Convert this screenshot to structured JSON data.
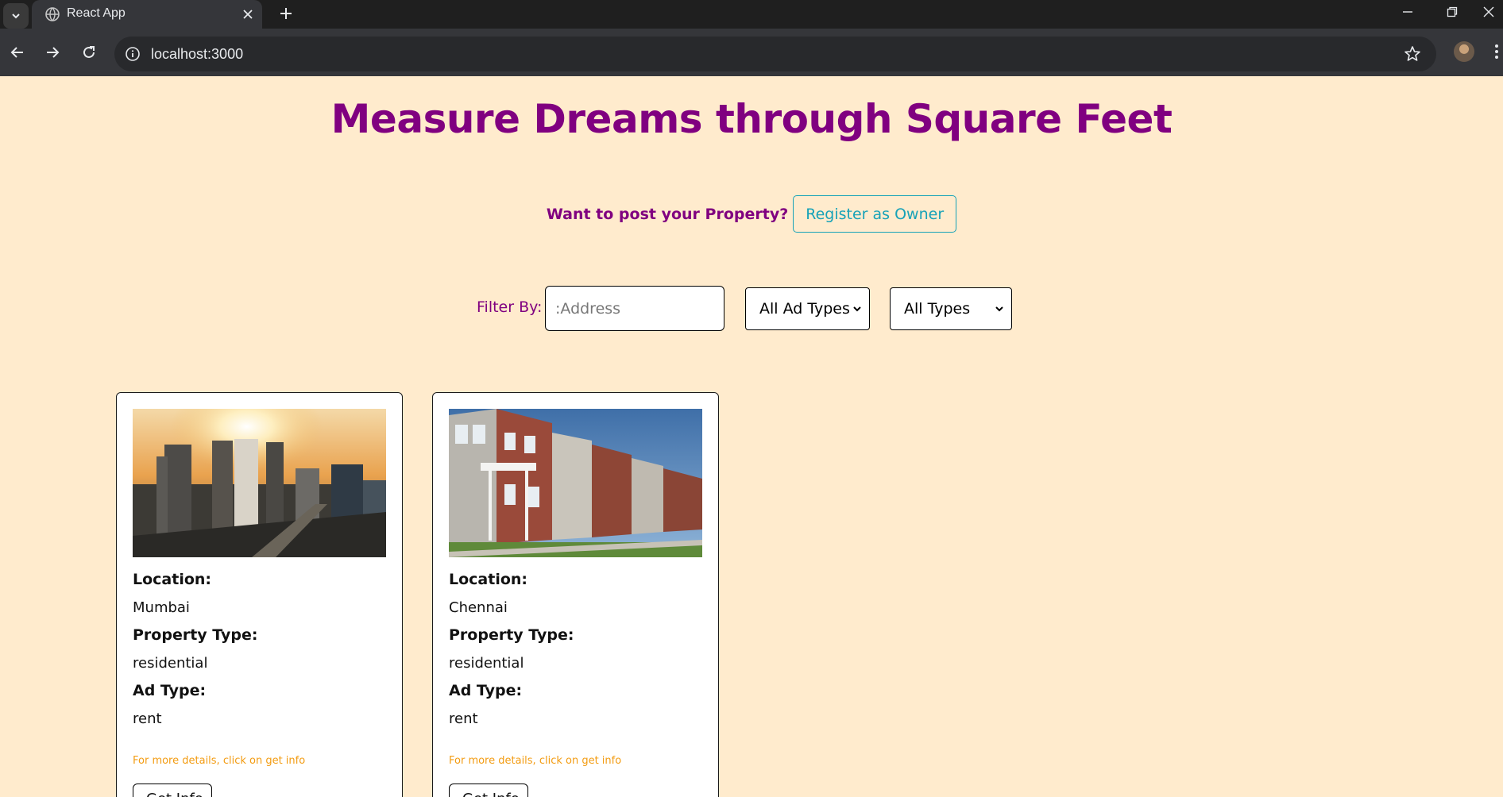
{
  "browser": {
    "tab_title": "React App",
    "url": "localhost:3000"
  },
  "page": {
    "title": "Measure Dreams through Square Feet",
    "post_question": "Want to post your Property?",
    "register_button": "Register as Owner",
    "filter": {
      "label": "Filter By:",
      "address_placeholder": ":Address",
      "ad_type_selected": "All Ad Types",
      "type_selected": "All Types"
    },
    "cards": [
      {
        "image_icon": "city-skyline-photo",
        "location_label": "Location:",
        "location": "Mumbai",
        "property_type_label": "Property Type:",
        "property_type": "residential",
        "ad_type_label": "Ad Type:",
        "ad_type": "rent",
        "hint": "For more details, click on get info",
        "button": "Get Info"
      },
      {
        "image_icon": "townhouses-photo",
        "location_label": "Location:",
        "location": "Chennai",
        "property_type_label": "Property Type:",
        "property_type": "residential",
        "ad_type_label": "Ad Type:",
        "ad_type": "rent",
        "hint": "For more details, click on get info",
        "button": "Get Info"
      }
    ]
  },
  "colors": {
    "page_bg": "#ffebcd",
    "accent_purple": "#800080",
    "accent_teal": "#17a2b8",
    "hint_orange": "#f39c12"
  }
}
